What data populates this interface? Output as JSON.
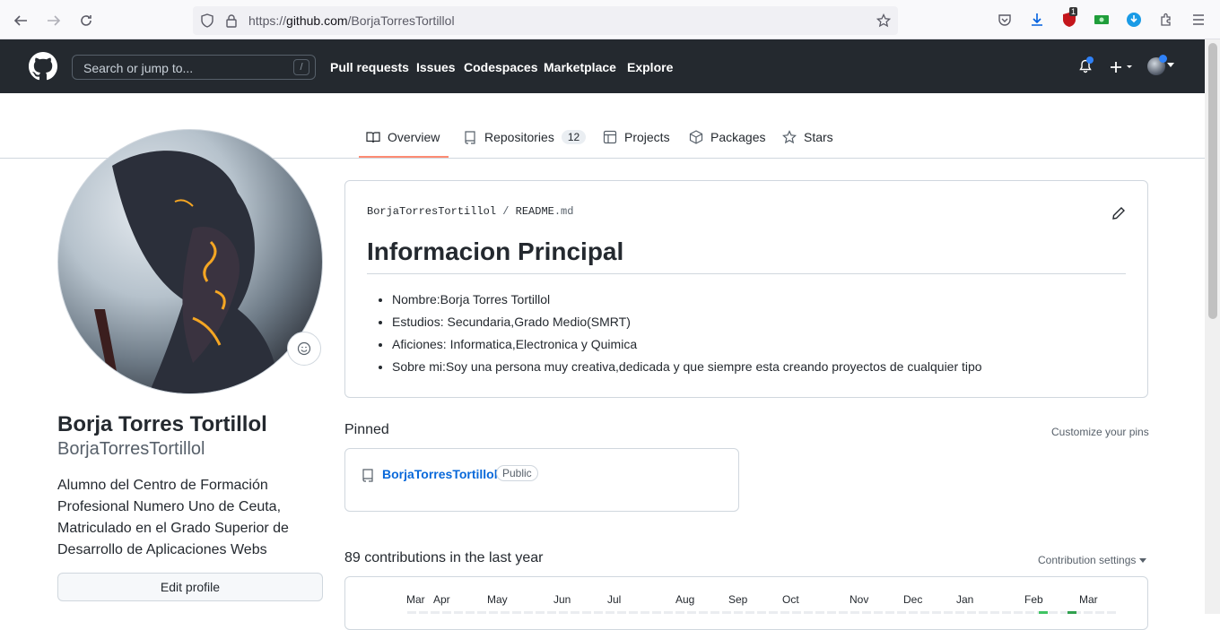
{
  "browser": {
    "url_protocol": "https://",
    "url_host": "github.com",
    "url_path": "/BorjaTorresTortillol",
    "ext_badge_count": "1"
  },
  "header": {
    "search_placeholder": "Search or jump to...",
    "search_shortcut": "/",
    "nav": [
      "Pull requests",
      "Issues",
      "Codespaces",
      "Marketplace",
      "Explore"
    ]
  },
  "tabs": {
    "overview": "Overview",
    "repositories": "Repositories",
    "repositories_count": "12",
    "projects": "Projects",
    "packages": "Packages",
    "stars": "Stars"
  },
  "profile": {
    "full_name": "Borja Torres Tortillol",
    "username": "BorjaTorresTortillol",
    "bio": "Alumno del Centro de Formación Profesional Numero Uno de Ceuta, Matriculado en el Grado Superior de Desarrollo de Aplicaciones Webs",
    "edit_button": "Edit profile"
  },
  "readme": {
    "path_user": "BorjaTorresTortillol",
    "path_sep": "/",
    "path_file": "README",
    "path_ext": ".md",
    "heading": "Informacion Principal",
    "items": [
      "Nombre:Borja Torres Tortillol",
      "Estudios: Secundaria,Grado Medio(SMRT)",
      "Aficiones: Informatica,Electronica y Quimica",
      "Sobre mi:Soy una persona muy creativa,dedicada y que siempre esta creando proyectos de cualquier tipo"
    ]
  },
  "pinned": {
    "title": "Pinned",
    "customize": "Customize your pins",
    "repo_name": "BorjaTorresTortillol",
    "repo_visibility": "Public"
  },
  "contributions": {
    "title": "89 contributions in the last year",
    "settings": "Contribution settings",
    "months": [
      "Mar",
      "Apr",
      "May",
      "Jun",
      "Jul",
      "Aug",
      "Sep",
      "Oct",
      "Nov",
      "Dec",
      "Jan",
      "Feb",
      "Mar"
    ]
  },
  "colors": {
    "header_bg": "#24292f",
    "accent_underline": "#fd8c73",
    "link": "#0969da",
    "notification_dot": "#2f81f7"
  }
}
